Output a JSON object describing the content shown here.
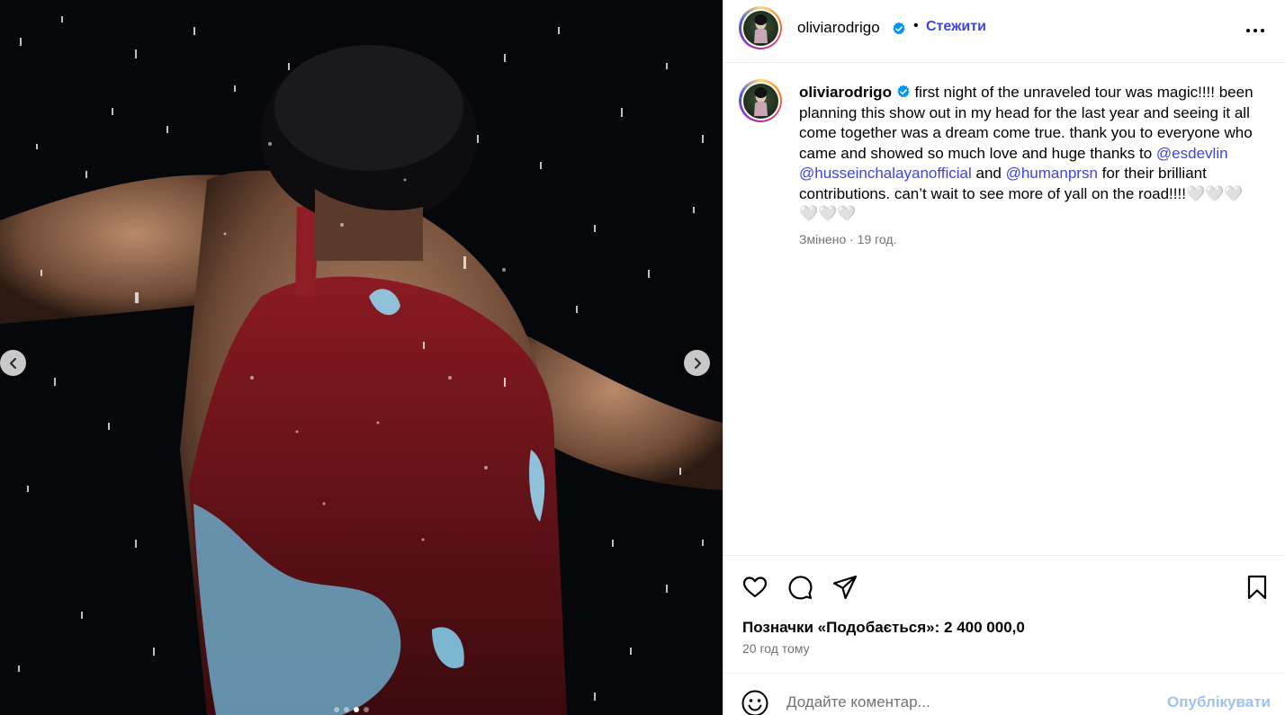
{
  "media": {
    "slide_count": 4,
    "active_slide": 3,
    "prev_icon": "chevron-left-icon",
    "next_icon": "chevron-right-icon"
  },
  "post": {
    "username": "oliviarodrigo",
    "verified": true,
    "separator": "•",
    "follow_label": "Стежити",
    "caption_parts": {
      "p1": "first night of the unraveled tour was magic!!!! been planning this show out in my head for the last year and seeing it all come together was a dream come true. thank you to everyone who came and showed so much love and huge thanks to ",
      "m1": "@esdevlin",
      "s1": " ",
      "m2": "@husseinchalayanofficial",
      "s2": " and ",
      "m3": "@humanprsn",
      "p2": " for their brilliant contributions. can’t wait to see more of yall on the road!!!!🤍🤍🤍🤍🤍🤍"
    },
    "meta": "Змінено · 19 год.",
    "likes": "Позначки «Подобається»: 2 400 000,0",
    "time_ago": "20 год тому"
  },
  "comment": {
    "placeholder": "Додайте коментар...",
    "publish_label": "Опублікувати"
  },
  "colors": {
    "accent": "#3b45e6",
    "publish_disabled": "#9ec2f4",
    "verified": "#0095f6",
    "muted": "#737373"
  },
  "icons": [
    "verified-badge-icon",
    "more-options-icon",
    "heart-icon",
    "comment-icon",
    "share-icon",
    "bookmark-icon",
    "emoji-icon"
  ]
}
